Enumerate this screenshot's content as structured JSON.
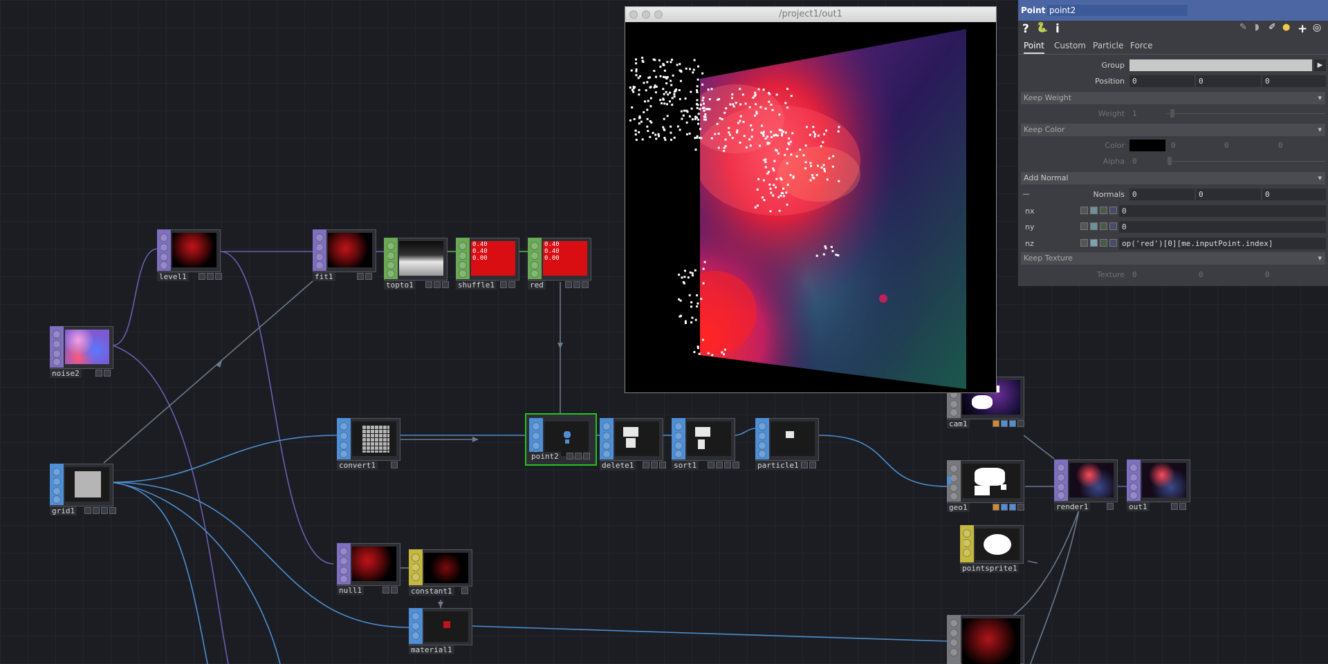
{
  "viewer": {
    "title": "/project1/out1"
  },
  "nodes": {
    "level1": "level1",
    "fit1": "fit1",
    "topto1": "topto1",
    "shuffle1": "shuffle1",
    "red": "red",
    "noise2": "noise2",
    "grid1": "grid1",
    "convert1": "convert1",
    "point2": "point2",
    "delete1": "delete1",
    "sort1": "sort1",
    "particle1": "particle1",
    "cam1": "cam1",
    "geo1": "geo1",
    "render1": "render1",
    "out1": "out1",
    "pointsprite1": "pointsprite1",
    "null1": "null1",
    "constant1": "constant1",
    "material1": "material1"
  },
  "chop_thumb": {
    "line1": "0.40",
    "line2": "0.40",
    "line3": "0.00"
  },
  "params": {
    "op_type": "Point",
    "op_name": "point2",
    "tabs": [
      "Point",
      "Custom",
      "Particle",
      "Force"
    ],
    "group_label": "Group",
    "group_value": "",
    "position_label": "Position",
    "position": [
      "0",
      "0",
      "0"
    ],
    "keep_weight": "Keep Weight",
    "weight_label": "Weight",
    "weight_value": "1",
    "keep_color": "Keep Color",
    "color_label": "Color",
    "color_values": [
      "0",
      "0",
      "0"
    ],
    "alpha_label": "Alpha",
    "alpha_value": "0",
    "add_normal": "Add Normal",
    "normals_label": "Normals",
    "normals": [
      "0",
      "0",
      "0"
    ],
    "nx_label": "nx",
    "nx_value": "0",
    "ny_label": "ny",
    "ny_value": "0",
    "nz_label": "nz",
    "nz_value": "op('red')[0][me.inputPoint.index]",
    "keep_texture": "Keep Texture",
    "texture_label": "Texture",
    "texture_values": [
      "0",
      "0",
      "0"
    ],
    "collapse_mark": "—"
  },
  "colors": {
    "top": "#7f6fbf",
    "sop": "#4f8fd6",
    "chop": "#6aa955",
    "mat": "#c5b83f",
    "comp": "#77797e",
    "wire_top": "#6a5fb0",
    "wire_sop": "#4d8fd0",
    "wire_gray": "#6c7a8c",
    "selected": "#27c21f"
  },
  "icons": [
    "help-icon",
    "python-icon",
    "info-icon",
    "edit-icon",
    "comment-icon",
    "cook-icon",
    "python-script-icon",
    "add-icon",
    "target-icon"
  ]
}
